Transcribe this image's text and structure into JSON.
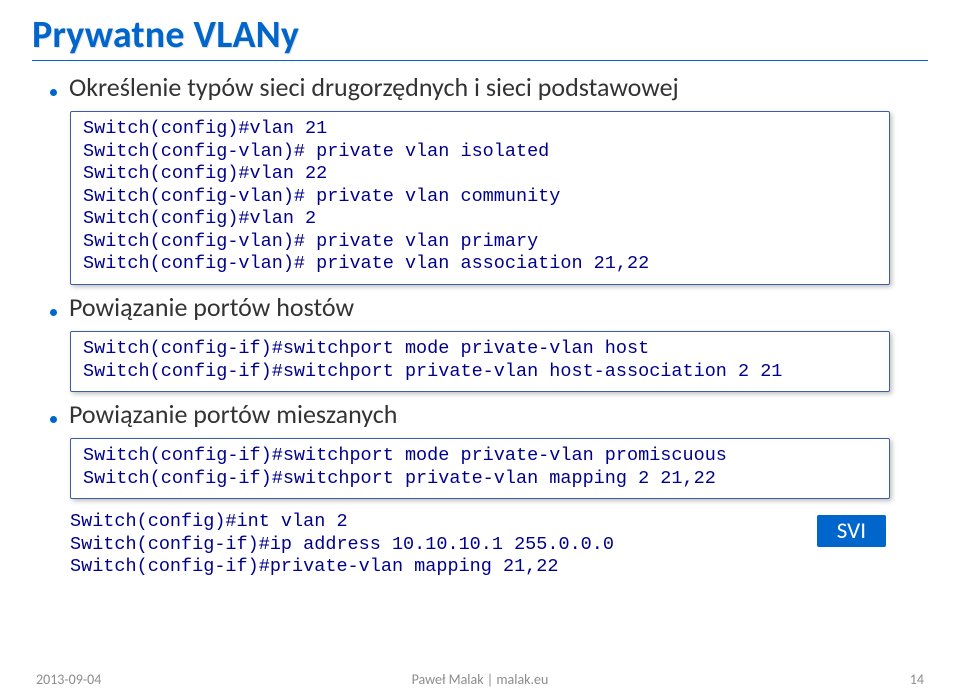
{
  "title": "Prywatne VLANy",
  "bullets": {
    "b1": "Określenie typów sieci drugorzędnych i sieci podstawowej",
    "b2": "Powiązanie portów hostów",
    "b3": "Powiązanie portów mieszanych"
  },
  "code1": {
    "l1": "Switch(config)#vlan 21",
    "l2": "Switch(config-vlan)# private vlan isolated",
    "l3": "Switch(config)#vlan 22",
    "l4": "Switch(config-vlan)# private vlan community",
    "l5": "Switch(config)#vlan 2",
    "l6": "Switch(config-vlan)# private vlan primary",
    "l7": "Switch(config-vlan)# private vlan association 21,22"
  },
  "code2": {
    "l1": "Switch(config-if)#switchport mode private-vlan host",
    "l2": "Switch(config-if)#switchport private-vlan host-association 2 21"
  },
  "code3": {
    "l1": "Switch(config-if)#switchport mode private-vlan promiscuous",
    "l2": "Switch(config-if)#switchport private-vlan mapping 2 21,22"
  },
  "code4": {
    "l1": "Switch(config)#int vlan 2",
    "l2": "Switch(config-if)#ip address 10.10.10.1 255.0.0.0",
    "l3": "Switch(config-if)#private-vlan mapping 21,22"
  },
  "svi_label": "SVI",
  "footer": {
    "date": "2013-09-04",
    "author": "Paweł Malak | malak.eu",
    "page": "14"
  }
}
